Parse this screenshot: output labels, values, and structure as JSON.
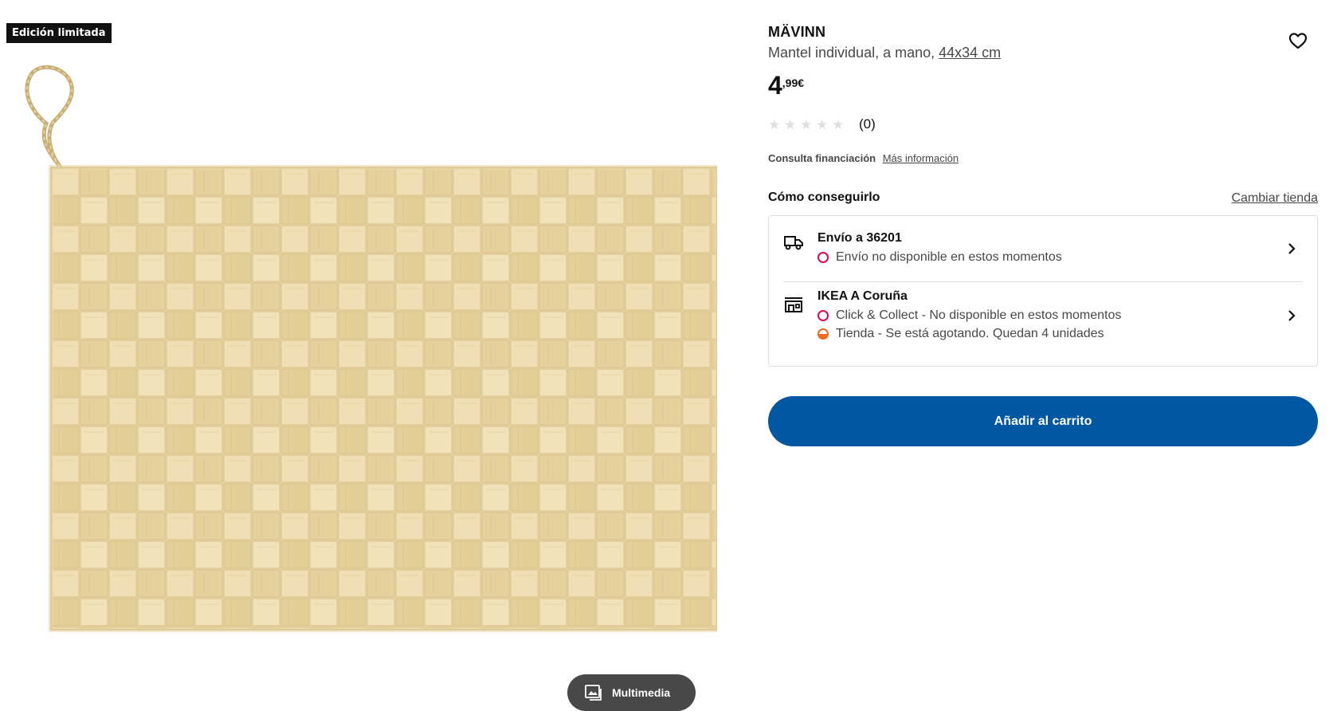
{
  "image_area": {
    "badge": "Edición limitada",
    "multimedia_label": "Multimedia"
  },
  "product": {
    "name": "MÄVINN",
    "description": "Mantel individual, a mano,",
    "dimensions": "44x34 cm",
    "price_integer": "4",
    "price_decimal": ",99",
    "price_currency": "€",
    "rating_stars": 0,
    "rating_max": 5,
    "rating_count": "(0)"
  },
  "finance": {
    "label": "Consulta financiación",
    "link": "Más información"
  },
  "availability": {
    "title": "Cómo conseguirlo",
    "change_store": "Cambiar tienda",
    "delivery": {
      "title": "Envío a 36201",
      "status": "Envío no disponible en estos momentos",
      "icon": "truck-icon"
    },
    "store": {
      "title": "IKEA A Coruña",
      "click_collect_status": "Click & Collect - No disponible en estos momentos",
      "store_status": "Tienda - Se está agotando. Quedan 4 unidades",
      "icon": "store-icon"
    }
  },
  "cart": {
    "label": "Añadir al carrito"
  },
  "colors": {
    "brand_blue": "#0058a3",
    "unavailable_red": "#e00751",
    "low_stock_orange": "#f26a21"
  }
}
